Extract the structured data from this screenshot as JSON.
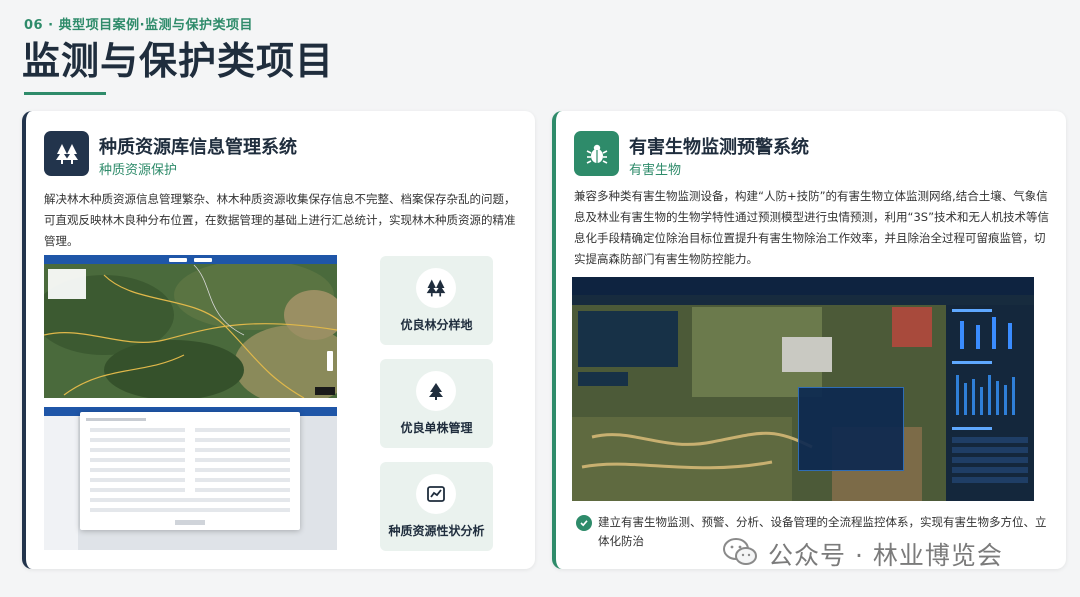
{
  "header": {
    "kicker": "06 · 典型项目案例·监测与保护类项目",
    "title": "监测与保护类项目"
  },
  "left_card": {
    "title": "种质资源库信息管理系统",
    "subtitle": "种质资源保护",
    "icon": "trees-icon",
    "description": "解决林木种质资源信息管理繁杂、林木种质资源收集保存信息不完整、档案保存杂乱的问题，可直观反映林木良种分布位置，在数据管理的基础上进行汇总统计，实现林木种质资源的精准管理。",
    "features": [
      {
        "label": "优良林分样地",
        "icon": "trees-icon"
      },
      {
        "label": "优良单株管理",
        "icon": "single-tree-icon"
      },
      {
        "label": "种质资源性状分析",
        "icon": "line-chart-icon"
      }
    ]
  },
  "right_card": {
    "title": "有害生物监测预警系统",
    "subtitle": "有害生物",
    "icon": "bug-icon",
    "description": "兼容多种类有害生物监测设备，构建“人防+技防”的有害生物立体监测网络,结合土壤、气象信息及林业有害生物的生物学特性通过预测模型进行虫情预测，利用“3S”技术和无人机技术等信息化手段精确定位除治目标位置提升有害生物除治工作效率，并且除治全过程可留痕监管，切实提高森防部门有害生物防控能力。",
    "bullet": "建立有害生物监测、预警、分析、设备管理的全流程监控体系，实现有害生物多方位、立体化防治"
  },
  "watermark": {
    "text": "公众号 · 林业博览会",
    "icon": "wechat-icon"
  },
  "colors": {
    "accent_green": "#2e8b6a",
    "navy": "#22344c",
    "feature_bg": "#eaf2ee"
  }
}
